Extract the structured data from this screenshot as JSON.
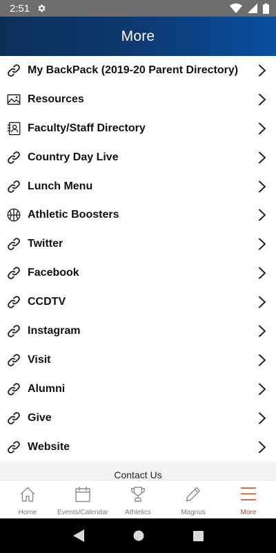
{
  "status_bar": {
    "time": "2:51"
  },
  "header": {
    "title": "More"
  },
  "menu": {
    "items": [
      {
        "label": "My BackPack (2019-20 Parent Directory)",
        "icon": "link-icon"
      },
      {
        "label": "Resources",
        "icon": "image-icon"
      },
      {
        "label": "Faculty/Staff Directory",
        "icon": "contact-card-icon"
      },
      {
        "label": "Country Day Live",
        "icon": "link-icon"
      },
      {
        "label": "Lunch Menu",
        "icon": "link-icon"
      },
      {
        "label": "Athletic Boosters",
        "icon": "basketball-icon"
      },
      {
        "label": "Twitter",
        "icon": "link-icon"
      },
      {
        "label": "Facebook",
        "icon": "link-icon"
      },
      {
        "label": "CCDTV",
        "icon": "link-icon"
      },
      {
        "label": "Instagram",
        "icon": "link-icon"
      },
      {
        "label": "Visit",
        "icon": "link-icon"
      },
      {
        "label": "Alumni",
        "icon": "link-icon"
      },
      {
        "label": "Give",
        "icon": "link-icon"
      },
      {
        "label": "Website",
        "icon": "link-icon"
      }
    ]
  },
  "contact": {
    "label": "Contact Us"
  },
  "tabs": [
    {
      "label": "Home",
      "icon": "home-icon"
    },
    {
      "label": "Events/Calendar",
      "icon": "calendar-icon"
    },
    {
      "label": "Athletics",
      "icon": "trophy-icon"
    },
    {
      "label": "Magnus",
      "icon": "pencil-icon"
    },
    {
      "label": "More",
      "icon": "hamburger-icon",
      "active": true
    }
  ],
  "colors": {
    "accent": "#b8471a",
    "header_start": "#0c2f57",
    "header_end": "#0a4fa0"
  }
}
